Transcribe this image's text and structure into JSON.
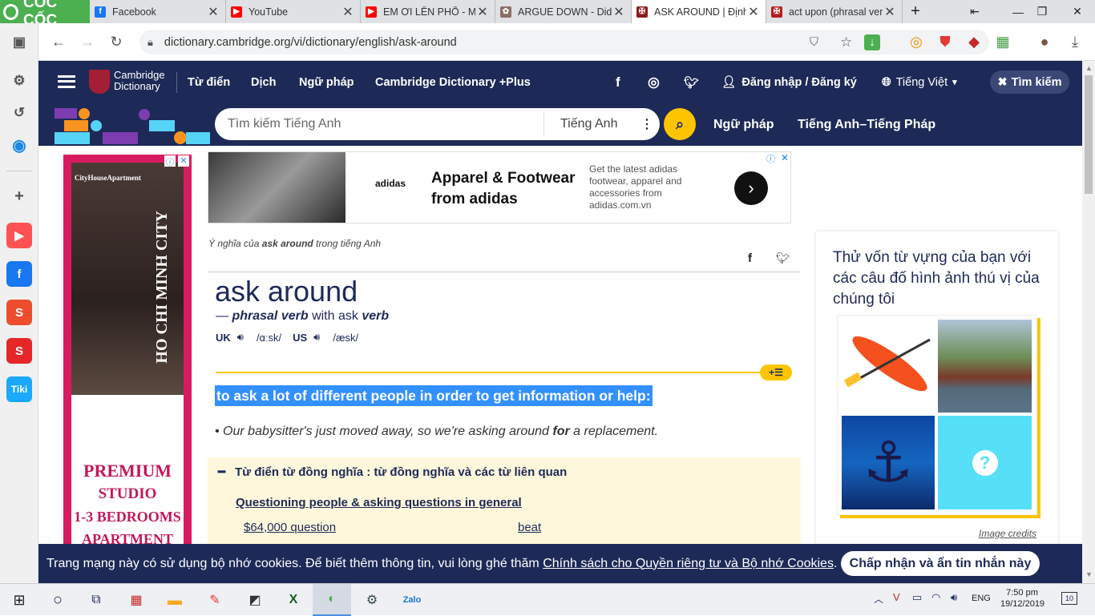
{
  "browser": {
    "brand": "CỐC CỐC",
    "tabs": [
      {
        "title": "Facebook",
        "color": "#1877f2",
        "glyph": "f"
      },
      {
        "title": "YouTube",
        "color": "#ff0000",
        "glyph": "▶"
      },
      {
        "title": "EM ƠI LÊN PHỐ - MI",
        "color": "#ff0000",
        "glyph": "▶"
      },
      {
        "title": "ARGUE DOWN - Did",
        "color": "#8d6e63",
        "glyph": "✿"
      },
      {
        "title": "ASK AROUND | Định",
        "color": "#8b1a1a",
        "glyph": "✠"
      },
      {
        "title": "act upon (phrasal ver",
        "color": "#b71c1c",
        "glyph": "✠"
      }
    ],
    "url": "dictionary.cambridge.org/vi/dictionary/english/ask-around"
  },
  "sidebar": {
    "items": [
      {
        "name": "youtube",
        "color": "#ff0000",
        "glyph": "▶"
      },
      {
        "name": "facebook",
        "color": "#1877f2",
        "glyph": "f"
      },
      {
        "name": "shopee",
        "color": "#ee4d2d",
        "glyph": "S"
      },
      {
        "name": "sendo",
        "color": "#e52727",
        "glyph": "S"
      },
      {
        "name": "tiki",
        "color": "#1ba8ff",
        "glyph": "Tiki"
      }
    ]
  },
  "header": {
    "logo_line1": "Cambridge",
    "logo_line2": "Dictionary",
    "nav": [
      "Từ điển",
      "Dịch",
      "Ngữ pháp",
      "Cambridge Dictionary +Plus"
    ],
    "login": "Đăng nhập / Đăng ký",
    "language": "Tiếng Việt",
    "search_button": "Tìm kiếm",
    "search_placeholder": "Tìm kiếm Tiếng Anh",
    "search_lang": "Tiếng Anh",
    "sub_links": [
      "Ngữ pháp",
      "Tiếng Anh–Tiếng Pháp"
    ]
  },
  "ad_left": {
    "brand": "CityHouseApartment",
    "vertical_text": "HO CHI MINH CITY",
    "line1": "PREMIUM",
    "line2": "STUDIO",
    "line3": "1-3 BEDROOMS",
    "line4": "APARTMENT"
  },
  "ad_top": {
    "headline": "Apparel & Footwear from adidas",
    "body": "Get the latest adidas footwear, apparel and accessories from adidas.com.vn",
    "logo": "adidas"
  },
  "entry": {
    "breadcrumb_prefix": "Ý nghĩa của",
    "breadcrumb_word": "ask around",
    "breadcrumb_suffix": "trong tiếng Anh",
    "headword": "ask around",
    "pos_prefix": "—",
    "pos": "phrasal verb",
    "with": "with ask",
    "verb": "verb",
    "uk_label": "UK",
    "uk_pron": "/ɑːsk/",
    "us_label": "US",
    "us_pron": "/æsk/",
    "definition": "to ask a lot of different people in order to get information or help:",
    "example_a": "Our babysitter's just moved away, so we're asking around",
    "example_b": "for",
    "example_c": "a replacement.",
    "synonyms_title": "Từ điển từ đồng nghĩa : từ đồng nghĩa và các từ liên quan",
    "synonyms_group": "Questioning people & asking questions in general",
    "syn_word_1": "$64,000 question",
    "syn_word_2": "beat"
  },
  "quiz": {
    "title": "Thử vốn từ vựng của bạn với các câu đố hình ảnh thú vị của chúng tôi",
    "credits": "Image credits"
  },
  "cookie": {
    "text": "Trang mạng này có sử dụng bộ nhớ cookies. Để biết thêm thông tin, vui lòng ghé thăm",
    "link": "Chính sách cho Quyền riêng tư và Bộ nhớ Cookies",
    "button": "Chấp nhận và ẩn tin nhắn này"
  },
  "taskbar": {
    "lang": "ENG",
    "time": "7:50 pm",
    "date": "19/12/2019",
    "notif": "10"
  }
}
